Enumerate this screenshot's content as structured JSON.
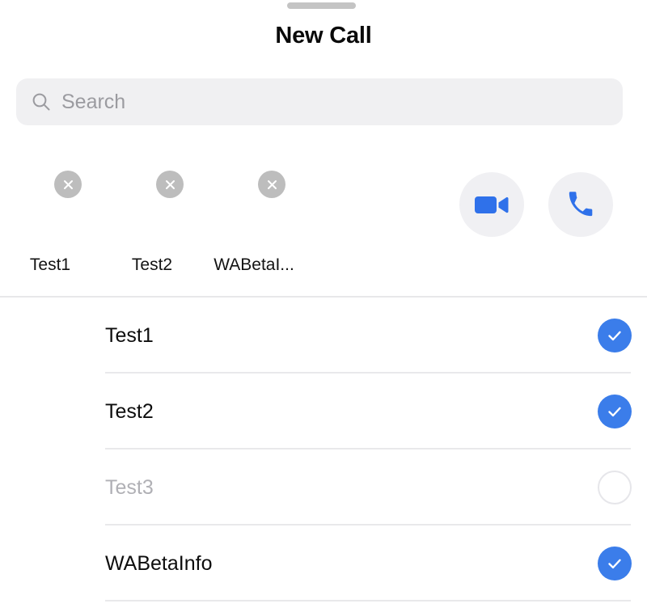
{
  "sheet": {
    "title": "New Call",
    "drag_handle": "drag-handle"
  },
  "search": {
    "placeholder": "Search",
    "value": "",
    "icon": "search-icon"
  },
  "selected_chips": [
    {
      "label": "Test1",
      "remove_icon": "close-icon"
    },
    {
      "label": "Test2",
      "remove_icon": "close-icon"
    },
    {
      "label": "WABetaI...",
      "remove_icon": "close-icon"
    }
  ],
  "call_actions": [
    {
      "name": "video-call-button",
      "icon": "video-camera-icon"
    },
    {
      "name": "voice-call-button",
      "icon": "phone-icon"
    }
  ],
  "contacts": [
    {
      "name": "Test1",
      "selected": true,
      "disabled": false
    },
    {
      "name": "Test2",
      "selected": true,
      "disabled": false
    },
    {
      "name": "Test3",
      "selected": false,
      "disabled": true
    },
    {
      "name": "WABetaInfo",
      "selected": true,
      "disabled": false
    }
  ],
  "colors": {
    "accent_blue": "#3b7dea",
    "chip_badge_gray": "#bdbdbd",
    "search_bg": "#f0f0f2",
    "button_bg": "#f0f0f3",
    "divider": "#e9e9eb",
    "disabled_text": "#b0b0b5",
    "handle": "#c4c4c4"
  }
}
